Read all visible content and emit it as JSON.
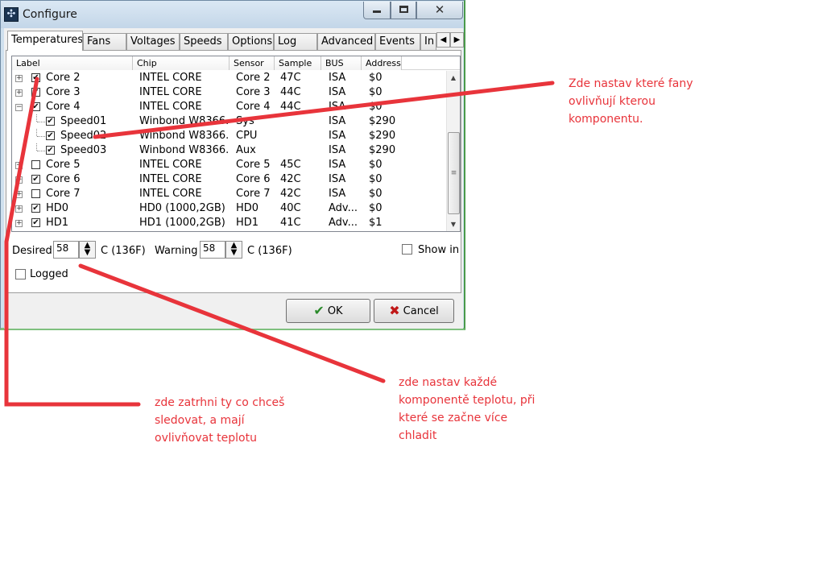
{
  "window": {
    "title": "Configure",
    "app_icon": "fan-icon"
  },
  "tabs": [
    {
      "label": "Temperatures",
      "active": true
    },
    {
      "label": "Fans"
    },
    {
      "label": "Voltages"
    },
    {
      "label": "Speeds"
    },
    {
      "label": "Options"
    },
    {
      "label": "Log"
    },
    {
      "label": "Advanced"
    },
    {
      "label": "Events"
    },
    {
      "label": "In"
    }
  ],
  "list": {
    "columns": [
      "Label",
      "Chip",
      "Sensor",
      "Sample",
      "BUS",
      "Address"
    ],
    "rows": [
      {
        "expander": "+",
        "checked": true,
        "level": 0,
        "label": "Core 2",
        "chip": "INTEL CORE",
        "sensor": "Core 2",
        "sample": "47C",
        "bus": "ISA",
        "address": "$0"
      },
      {
        "expander": "+",
        "checked": true,
        "level": 0,
        "label": "Core 3",
        "chip": "INTEL CORE",
        "sensor": "Core 3",
        "sample": "44C",
        "bus": "ISA",
        "address": "$0"
      },
      {
        "expander": "−",
        "checked": true,
        "level": 0,
        "label": "Core 4",
        "chip": "INTEL CORE",
        "sensor": "Core 4",
        "sample": "44C",
        "bus": "ISA",
        "address": "$0"
      },
      {
        "expander": "",
        "checked": true,
        "level": 1,
        "label": "Speed01",
        "chip": "Winbond W8366...",
        "sensor": "Sys",
        "sample": "",
        "bus": "ISA",
        "address": "$290"
      },
      {
        "expander": "",
        "checked": true,
        "level": 1,
        "label": "Speed02",
        "chip": "Winbond W8366...",
        "sensor": "CPU",
        "sample": "",
        "bus": "ISA",
        "address": "$290"
      },
      {
        "expander": "",
        "checked": true,
        "level": 1,
        "label": "Speed03",
        "chip": "Winbond W8366...",
        "sensor": "Aux",
        "sample": "",
        "bus": "ISA",
        "address": "$290"
      },
      {
        "expander": "+",
        "checked": false,
        "level": 0,
        "label": "Core 5",
        "chip": "INTEL CORE",
        "sensor": "Core 5",
        "sample": "45C",
        "bus": "ISA",
        "address": "$0"
      },
      {
        "expander": "+",
        "checked": true,
        "level": 0,
        "label": "Core 6",
        "chip": "INTEL CORE",
        "sensor": "Core 6",
        "sample": "42C",
        "bus": "ISA",
        "address": "$0"
      },
      {
        "expander": "+",
        "checked": false,
        "level": 0,
        "label": "Core 7",
        "chip": "INTEL CORE",
        "sensor": "Core 7",
        "sample": "42C",
        "bus": "ISA",
        "address": "$0"
      },
      {
        "expander": "+",
        "checked": true,
        "level": 0,
        "label": "HD0",
        "chip": "HD0 (1000,2GB)",
        "sensor": "HD0",
        "sample": "40C",
        "bus": "Adv...",
        "address": "$0"
      },
      {
        "expander": "+",
        "checked": true,
        "level": 0,
        "label": "HD1",
        "chip": "HD1 (1000,2GB)",
        "sensor": "HD1",
        "sample": "41C",
        "bus": "Adv...",
        "address": "$1"
      }
    ]
  },
  "form": {
    "desired_label": "Desired",
    "desired_value": "58",
    "desired_unit": "C (136F)",
    "warning_label": "Warning",
    "warning_value": "58",
    "warning_unit": "C (136F)",
    "show_in_label": "Show in",
    "logged_label": "Logged"
  },
  "buttons": {
    "ok_label": "OK",
    "cancel_label": "Cancel"
  },
  "annotations": {
    "color": "#e8343b",
    "fans": "Zde nastav které fany\novlivňují kterou\nkomponentu.",
    "temps": "zde nastav každé\nkomponentě teplotu, při\nkteré se začne více\nchladit",
    "check": "zde zatrhni ty co chceš\nsledovat, a mají\novlivňovat teplotu"
  }
}
